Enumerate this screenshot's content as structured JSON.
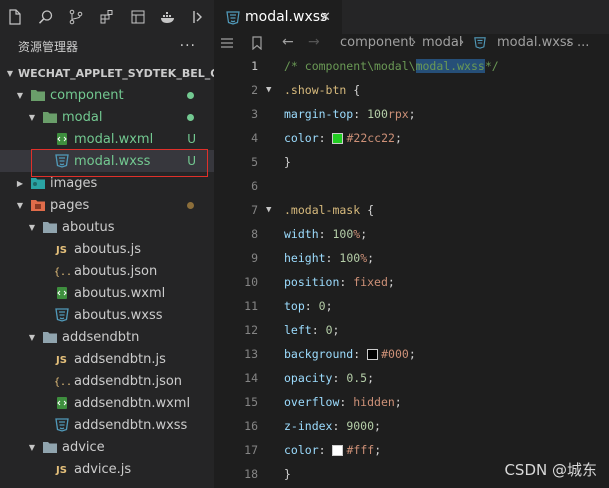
{
  "sidebar": {
    "title": "资源管理器",
    "more": "···",
    "toolbar_icons": [
      "files-icon",
      "search-icon",
      "source-control-icon",
      "extensions-icon",
      "debug-icon",
      "docker-icon",
      "panel-icon"
    ],
    "root": "WECHAT_APPLET_SYDTEK_BEL_OTA",
    "tree": [
      {
        "label": "component",
        "depth": 1,
        "type": "folder",
        "open": true,
        "color": "#73c991",
        "status_dot": "#73c991"
      },
      {
        "label": "modal",
        "depth": 2,
        "type": "folder",
        "open": true,
        "color": "#73c991",
        "status_dot": "#73c991"
      },
      {
        "label": "modal.wxml",
        "depth": 3,
        "type": "wxml",
        "color": "#73c991",
        "status": "U"
      },
      {
        "label": "modal.wxss",
        "depth": 3,
        "type": "wxss",
        "color": "#73c991",
        "status": "U",
        "selected": true
      },
      {
        "label": "images",
        "depth": 1,
        "type": "images",
        "open": false,
        "color": "#cccccc"
      },
      {
        "label": "pages",
        "depth": 1,
        "type": "pages",
        "open": true,
        "color": "#cccccc",
        "status_dot": "#8c6e3a"
      },
      {
        "label": "aboutus",
        "depth": 2,
        "type": "folder",
        "open": true,
        "color": "#cccccc"
      },
      {
        "label": "aboutus.js",
        "depth": 3,
        "type": "js",
        "color": "#cccccc"
      },
      {
        "label": "aboutus.json",
        "depth": 3,
        "type": "json",
        "color": "#cccccc"
      },
      {
        "label": "aboutus.wxml",
        "depth": 3,
        "type": "wxml",
        "color": "#cccccc"
      },
      {
        "label": "aboutus.wxss",
        "depth": 3,
        "type": "wxss",
        "color": "#cccccc"
      },
      {
        "label": "addsendbtn",
        "depth": 2,
        "type": "folder",
        "open": true,
        "color": "#cccccc"
      },
      {
        "label": "addsendbtn.js",
        "depth": 3,
        "type": "js",
        "color": "#cccccc"
      },
      {
        "label": "addsendbtn.json",
        "depth": 3,
        "type": "json",
        "color": "#cccccc"
      },
      {
        "label": "addsendbtn.wxml",
        "depth": 3,
        "type": "wxml",
        "color": "#cccccc"
      },
      {
        "label": "addsendbtn.wxss",
        "depth": 3,
        "type": "wxss",
        "color": "#cccccc"
      },
      {
        "label": "advice",
        "depth": 2,
        "type": "folder",
        "open": true,
        "color": "#cccccc"
      },
      {
        "label": "advice.js",
        "depth": 3,
        "type": "js",
        "color": "#cccccc"
      }
    ]
  },
  "editor": {
    "tab": {
      "label": "modal.wxss",
      "close": "✕"
    },
    "breadcrumb": [
      "component",
      "modal",
      "modal.wxss",
      "..."
    ],
    "lines": [
      {
        "n": "1",
        "tokens": [
          [
            "cm",
            "/* component\\modal\\"
          ],
          [
            "cmhl",
            "modal.wxss"
          ],
          [
            "cm",
            "*/"
          ]
        ]
      },
      {
        "n": "2",
        "fold": true,
        "tokens": [
          [
            "sel-c",
            ".show-btn"
          ],
          [
            "punc",
            " {"
          ]
        ]
      },
      {
        "n": "3",
        "tokens": [
          [
            "prop",
            "margin-top"
          ],
          [
            "punc",
            ": "
          ],
          [
            "num",
            "100"
          ],
          [
            "kw",
            "rpx"
          ],
          [
            "punc",
            ";"
          ]
        ]
      },
      {
        "n": "4",
        "tokens": [
          [
            "prop",
            "color"
          ],
          [
            "punc",
            ": "
          ],
          [
            "swatch",
            "#22cc22"
          ],
          [
            "kw",
            "#22cc22"
          ],
          [
            "punc",
            ";"
          ]
        ]
      },
      {
        "n": "5",
        "tokens": [
          [
            "punc",
            "}"
          ]
        ]
      },
      {
        "n": "6",
        "tokens": []
      },
      {
        "n": "7",
        "fold": true,
        "tokens": [
          [
            "sel-c",
            ".modal-mask"
          ],
          [
            "punc",
            " {"
          ]
        ]
      },
      {
        "n": "8",
        "tokens": [
          [
            "prop",
            "width"
          ],
          [
            "punc",
            ": "
          ],
          [
            "num",
            "100"
          ],
          [
            "kw",
            "%"
          ],
          [
            "punc",
            ";"
          ]
        ]
      },
      {
        "n": "9",
        "tokens": [
          [
            "prop",
            "height"
          ],
          [
            "punc",
            ": "
          ],
          [
            "num",
            "100"
          ],
          [
            "kw",
            "%"
          ],
          [
            "punc",
            ";"
          ]
        ]
      },
      {
        "n": "10",
        "tokens": [
          [
            "prop",
            "position"
          ],
          [
            "punc",
            ": "
          ],
          [
            "kw",
            "fixed"
          ],
          [
            "punc",
            ";"
          ]
        ]
      },
      {
        "n": "11",
        "tokens": [
          [
            "prop",
            "top"
          ],
          [
            "punc",
            ": "
          ],
          [
            "num",
            "0"
          ],
          [
            "punc",
            ";"
          ]
        ]
      },
      {
        "n": "12",
        "tokens": [
          [
            "prop",
            "left"
          ],
          [
            "punc",
            ": "
          ],
          [
            "num",
            "0"
          ],
          [
            "punc",
            ";"
          ]
        ]
      },
      {
        "n": "13",
        "tokens": [
          [
            "prop",
            "background"
          ],
          [
            "punc",
            ": "
          ],
          [
            "swatch",
            "#000000"
          ],
          [
            "kw",
            "#000"
          ],
          [
            "punc",
            ";"
          ]
        ]
      },
      {
        "n": "14",
        "tokens": [
          [
            "prop",
            "opacity"
          ],
          [
            "punc",
            ": "
          ],
          [
            "num",
            "0.5"
          ],
          [
            "punc",
            ";"
          ]
        ]
      },
      {
        "n": "15",
        "tokens": [
          [
            "prop",
            "overflow"
          ],
          [
            "punc",
            ": "
          ],
          [
            "kw",
            "hidden"
          ],
          [
            "punc",
            ";"
          ]
        ]
      },
      {
        "n": "16",
        "tokens": [
          [
            "prop",
            "z-index"
          ],
          [
            "punc",
            ": "
          ],
          [
            "num",
            "9000"
          ],
          [
            "punc",
            ";"
          ]
        ]
      },
      {
        "n": "17",
        "tokens": [
          [
            "prop",
            "color"
          ],
          [
            "punc",
            ": "
          ],
          [
            "swatch",
            "#ffffff"
          ],
          [
            "kw",
            "#fff"
          ],
          [
            "punc",
            ";"
          ]
        ]
      },
      {
        "n": "18",
        "tokens": [
          [
            "punc",
            "}"
          ]
        ]
      }
    ]
  },
  "watermark": "CSDN @城东",
  "colors": {
    "accent": "#519aba",
    "untracked": "#73c991",
    "highlight_box": "#e0302a"
  }
}
